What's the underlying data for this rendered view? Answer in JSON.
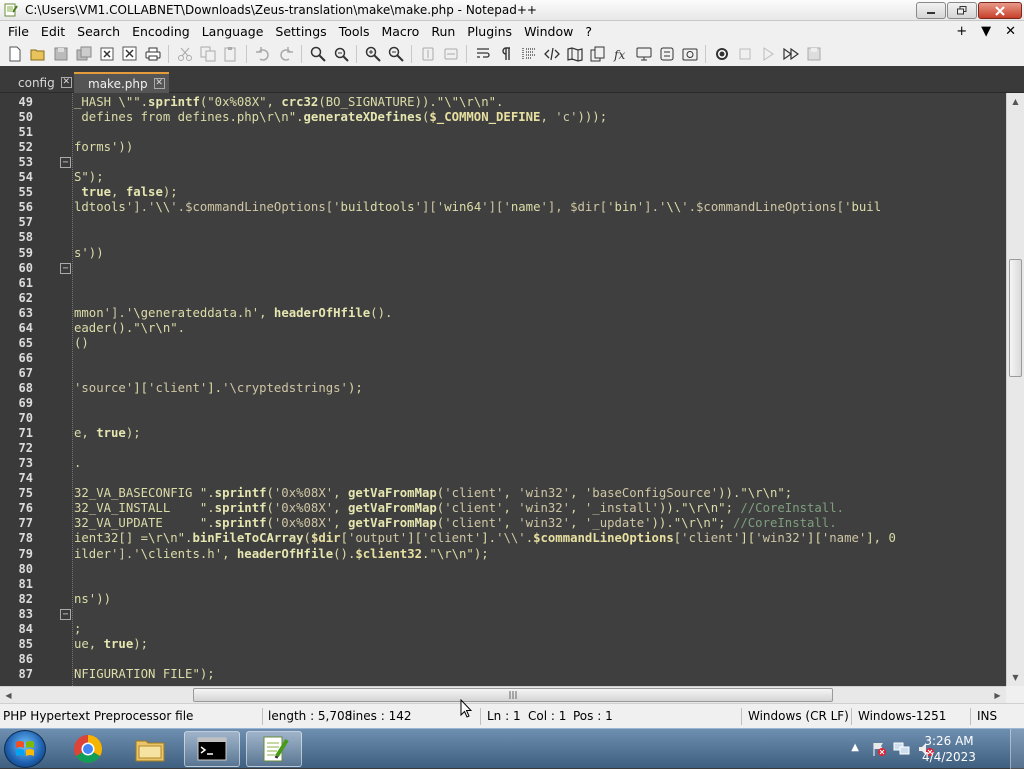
{
  "window": {
    "title": "C:\\Users\\VM1.COLLABNET\\Downloads\\Zeus-translation\\make\\make.php - Notepad++"
  },
  "menu": {
    "items": [
      "File",
      "Edit",
      "Search",
      "Encoding",
      "Language",
      "Settings",
      "Tools",
      "Macro",
      "Run",
      "Plugins",
      "Window",
      "?"
    ],
    "right": [
      "+",
      "▼",
      "✕"
    ]
  },
  "tabs": [
    {
      "label": "config",
      "active": false
    },
    {
      "label": "make.php",
      "active": true
    }
  ],
  "editor": {
    "lines": [
      {
        "n": "49",
        "fold": false,
        "code": "_HASH \\\"\".sprintf(\"0x%08X\", crc32(BO_SIGNATURE)).\"\\\"\\r\\n\"."
      },
      {
        "n": "50",
        "fold": false,
        "code": " defines from defines.php\\r\\n\".generateXDefines($_COMMON_DEFINE, 'c')));"
      },
      {
        "n": "51",
        "fold": false,
        "code": ""
      },
      {
        "n": "52",
        "fold": false,
        "code": "forms'))"
      },
      {
        "n": "53",
        "fold": true,
        "code": ""
      },
      {
        "n": "54",
        "fold": false,
        "code": "S\");"
      },
      {
        "n": "55",
        "fold": false,
        "code": " true, false);"
      },
      {
        "n": "56",
        "fold": false,
        "code": "ldtools'].'\\\\'.$commandLineOptions['buildtools']['win64']['name'], $dir['bin'].'\\\\'.$commandLineOptions['buil"
      },
      {
        "n": "57",
        "fold": false,
        "code": ""
      },
      {
        "n": "58",
        "fold": false,
        "code": ""
      },
      {
        "n": "59",
        "fold": false,
        "code": "s'))"
      },
      {
        "n": "60",
        "fold": true,
        "code": ""
      },
      {
        "n": "61",
        "fold": false,
        "code": ""
      },
      {
        "n": "62",
        "fold": false,
        "code": ""
      },
      {
        "n": "63",
        "fold": false,
        "code": "mmon'].'\\generateddata.h', headerOfHfile()."
      },
      {
        "n": "64",
        "fold": false,
        "code": "eader().\"\\r\\n\"."
      },
      {
        "n": "65",
        "fold": false,
        "code": "()"
      },
      {
        "n": "66",
        "fold": false,
        "code": ""
      },
      {
        "n": "67",
        "fold": false,
        "code": ""
      },
      {
        "n": "68",
        "fold": false,
        "code": "'source']['client'].'\\cryptedstrings');"
      },
      {
        "n": "69",
        "fold": false,
        "code": ""
      },
      {
        "n": "70",
        "fold": false,
        "code": ""
      },
      {
        "n": "71",
        "fold": false,
        "code": "e, true);"
      },
      {
        "n": "72",
        "fold": false,
        "code": ""
      },
      {
        "n": "73",
        "fold": false,
        "code": "."
      },
      {
        "n": "74",
        "fold": false,
        "code": ""
      },
      {
        "n": "75",
        "fold": false,
        "code": "32_VA_BASECONFIG \".sprintf('0x%08X', getVaFromMap('client', 'win32', 'baseConfigSource')).\"\\r\\n\";"
      },
      {
        "n": "76",
        "fold": false,
        "code": "32_VA_INSTALL    \".sprintf('0x%08X', getVaFromMap('client', 'win32', '_install')).\"\\r\\n\"; //CoreInstall."
      },
      {
        "n": "77",
        "fold": false,
        "code": "32_VA_UPDATE     \".sprintf('0x%08X', getVaFromMap('client', 'win32', '_update')).\"\\r\\n\"; //CoreInstall."
      },
      {
        "n": "78",
        "fold": false,
        "code": "ient32[] =\\r\\n\".binFileToCArray($dir['output']['client'].'\\\\'.$commandLineOptions['client']['win32']['name'], 0"
      },
      {
        "n": "79",
        "fold": false,
        "code": "ilder'].'\\clients.h', headerOfHfile().$client32.\"\\r\\n\");"
      },
      {
        "n": "80",
        "fold": false,
        "code": ""
      },
      {
        "n": "81",
        "fold": false,
        "code": ""
      },
      {
        "n": "82",
        "fold": false,
        "code": "ns'))"
      },
      {
        "n": "83",
        "fold": true,
        "code": ""
      },
      {
        "n": "84",
        "fold": false,
        "code": ";"
      },
      {
        "n": "85",
        "fold": false,
        "code": "ue, true);"
      },
      {
        "n": "86",
        "fold": false,
        "code": ""
      },
      {
        "n": "87",
        "fold": false,
        "code": "NFIGURATION FILE\");"
      }
    ]
  },
  "status": {
    "filetype": "PHP Hypertext Preprocessor file",
    "length": "length : 5,708",
    "lines": "lines : 142",
    "ln": "Ln : 1",
    "col": "Col : 1",
    "pos": "Pos : 1",
    "eol": "Windows (CR LF)",
    "encoding": "Windows-1251",
    "mode": "INS"
  },
  "taskbar": {
    "time": "3:26 AM",
    "date": "4/4/2023"
  }
}
